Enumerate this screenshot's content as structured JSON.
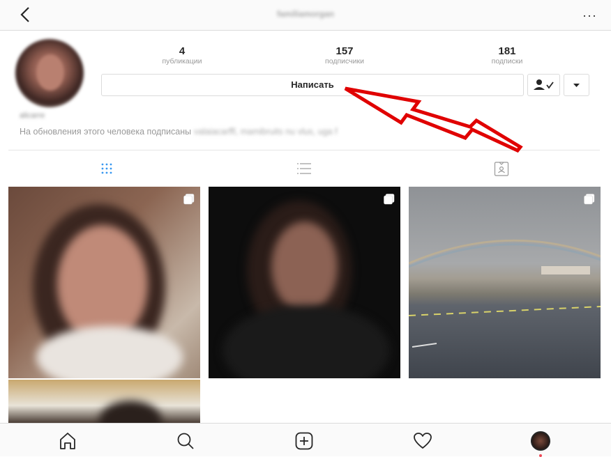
{
  "header": {
    "username": "familiamorgan",
    "more_label": "···"
  },
  "profile": {
    "full_name": "alicarre",
    "stats": [
      {
        "value": "4",
        "label": "публикации"
      },
      {
        "value": "157",
        "label": "подписчики"
      },
      {
        "value": "181",
        "label": "подписки"
      }
    ],
    "message_button": "Написать",
    "followed_by_text": "На обновления этого человека подписаны",
    "followed_by_names": "valaiacarffl, mamibruits nu vlus, uga f"
  },
  "tabs": [
    {
      "icon": "grid-icon",
      "active": true
    },
    {
      "icon": "list-icon",
      "active": false
    },
    {
      "icon": "tagged-icon",
      "active": false
    }
  ],
  "posts_count": 4,
  "bottom_nav": [
    "home-icon",
    "search-icon",
    "add-post-icon",
    "heart-icon",
    "profile-avatar"
  ],
  "colors": {
    "active_tab": "#3897f0",
    "annotation_arrow": "#e00000",
    "notification_dot": "#ed4956"
  }
}
